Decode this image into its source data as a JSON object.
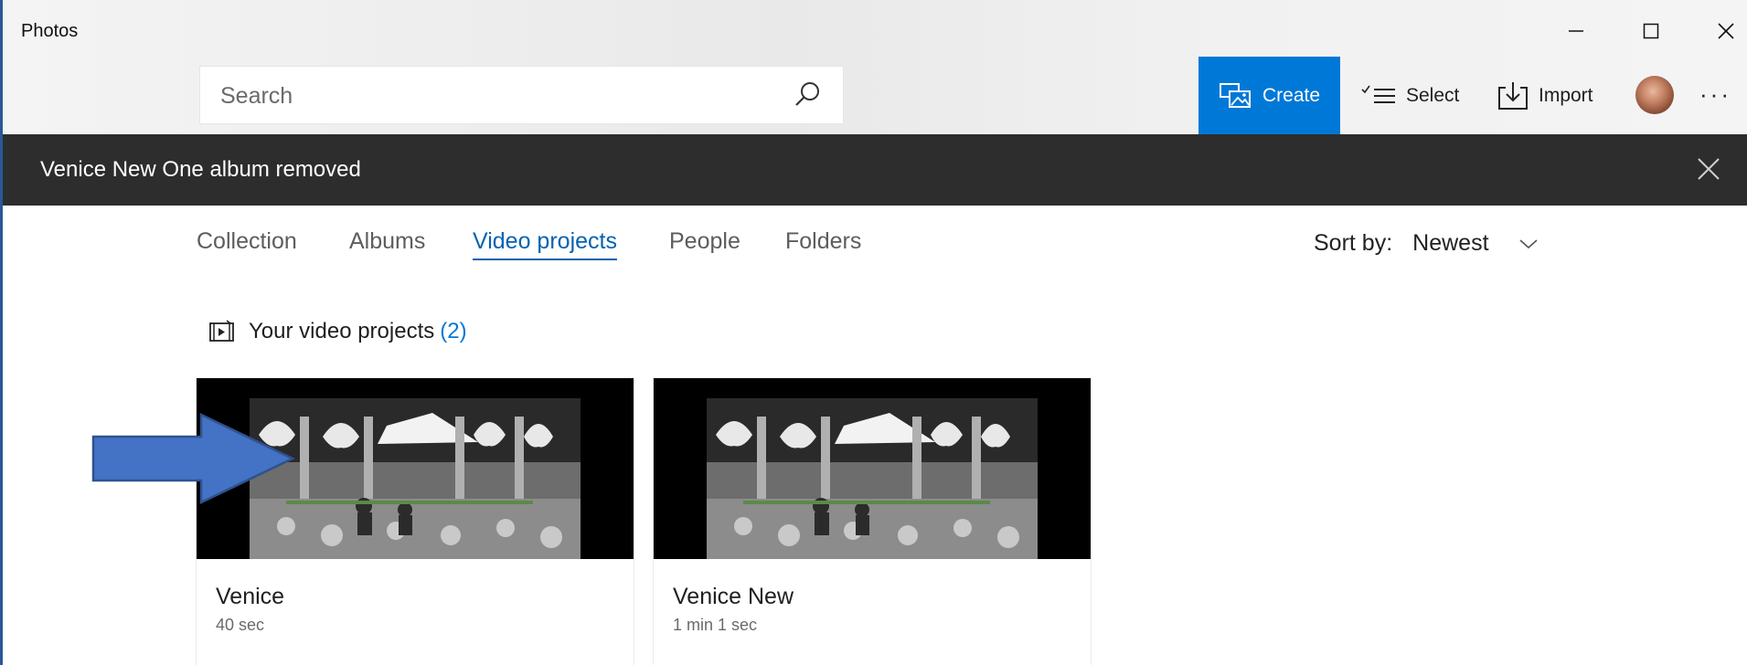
{
  "app": {
    "title": "Photos"
  },
  "window_controls": {
    "minimize": "minimize",
    "maximize": "maximize",
    "close": "close"
  },
  "search": {
    "placeholder": "Search",
    "value": ""
  },
  "toolbar": {
    "create_label": "Create",
    "select_label": "Select",
    "import_label": "Import",
    "more_label": "···"
  },
  "notification": {
    "text": "Venice New One album removed"
  },
  "tabs": [
    {
      "label": "Collection",
      "active": false
    },
    {
      "label": "Albums",
      "active": false
    },
    {
      "label": "Video projects",
      "active": true
    },
    {
      "label": "People",
      "active": false
    },
    {
      "label": "Folders",
      "active": false
    }
  ],
  "sort": {
    "label": "Sort by:",
    "value": "Newest"
  },
  "section": {
    "title": "Your video projects",
    "count": "(2)"
  },
  "projects": [
    {
      "title": "Venice",
      "duration": "40 sec"
    },
    {
      "title": "Venice New",
      "duration": "1 min 1 sec"
    }
  ],
  "colors": {
    "accent": "#0078d7",
    "notification_bg": "#2d2d2d",
    "arrow": "#4472c4"
  },
  "icons": [
    "close-icon",
    "minimize-icon",
    "maximize-icon",
    "search-icon",
    "create-icon",
    "select-icon",
    "import-icon",
    "video-project-icon",
    "chevron-down-icon"
  ]
}
